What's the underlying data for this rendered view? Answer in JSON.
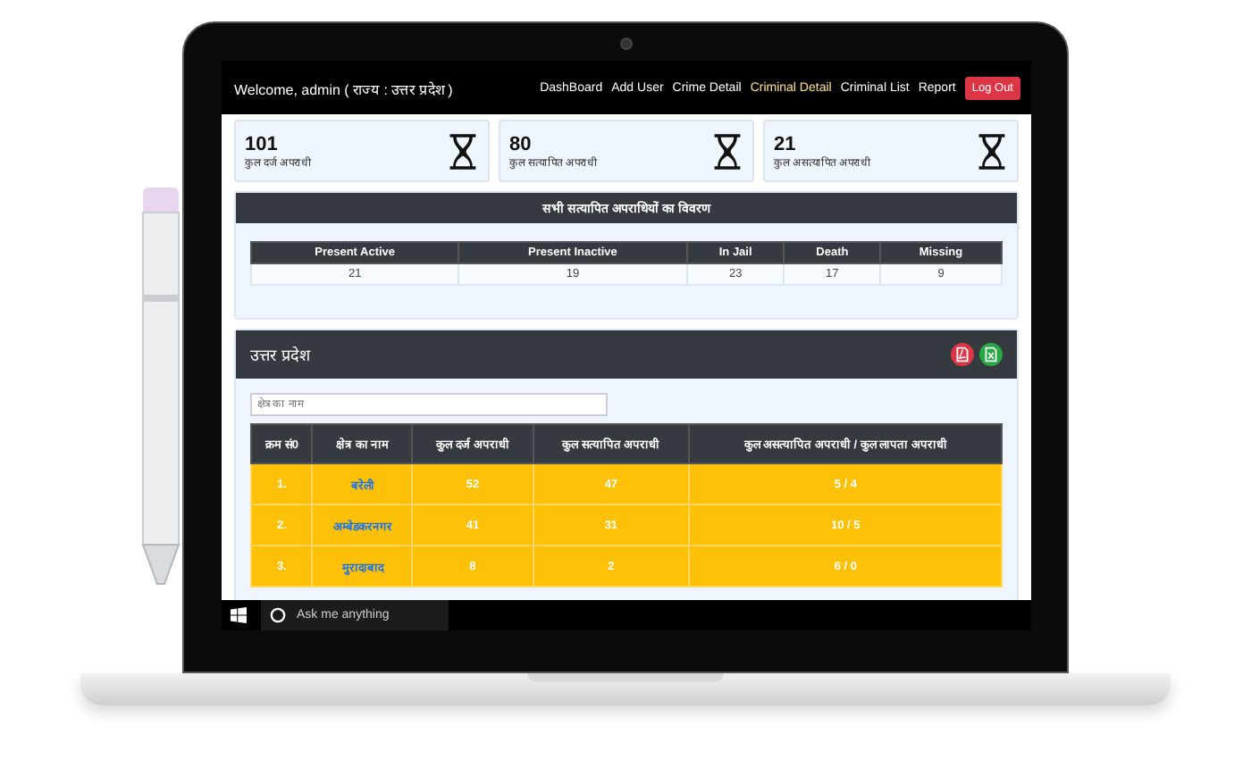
{
  "navbar": {
    "welcome": "Welcome, admin ( राज्य : उत्तर प्रदेश )",
    "links": [
      {
        "label": "DashBoard",
        "selected": false
      },
      {
        "label": "Add User",
        "selected": false
      },
      {
        "label": "Crime Detail",
        "selected": false
      },
      {
        "label": "Criminal Detail",
        "selected": true
      },
      {
        "label": "Criminal List",
        "selected": false
      },
      {
        "label": "Report",
        "selected": false
      }
    ],
    "logout": "Log Out"
  },
  "stats": [
    {
      "value": "101",
      "label": "कुल दर्ज अपराधी"
    },
    {
      "value": "80",
      "label": "कुल सत्यापित अपराधी"
    },
    {
      "value": "21",
      "label": "कुल असत्यापित अपराधी"
    }
  ],
  "summary": {
    "title": "सभी सत्यापित अपराधियों का विवरण",
    "columns": [
      "Present Active",
      "Present Inactive",
      "In Jail",
      "Death",
      "Missing"
    ],
    "values": [
      "21",
      "19",
      "23",
      "17",
      "9"
    ]
  },
  "region": {
    "title": "उत्तर प्रदेश",
    "search": {
      "placeholder": "क्षेत्र का नाम"
    },
    "columns": [
      "क्रम सं0",
      "क्षेत्र का नाम",
      "कुल दर्ज अपराधी",
      "कुल सत्यापित अपराधी",
      "कुल असत्यापित अपराधी / कुल लापता अपराधी"
    ],
    "rows": [
      [
        "1.",
        "बरेली",
        "52",
        "47",
        "5 / 4"
      ],
      [
        "2.",
        "अम्बेडकरनगर",
        "41",
        "31",
        "10 / 5"
      ],
      [
        "3.",
        "मुरादाबाद",
        "8",
        "2",
        "6 / 0"
      ]
    ]
  },
  "taskbar": {
    "search": "Ask me anything"
  }
}
